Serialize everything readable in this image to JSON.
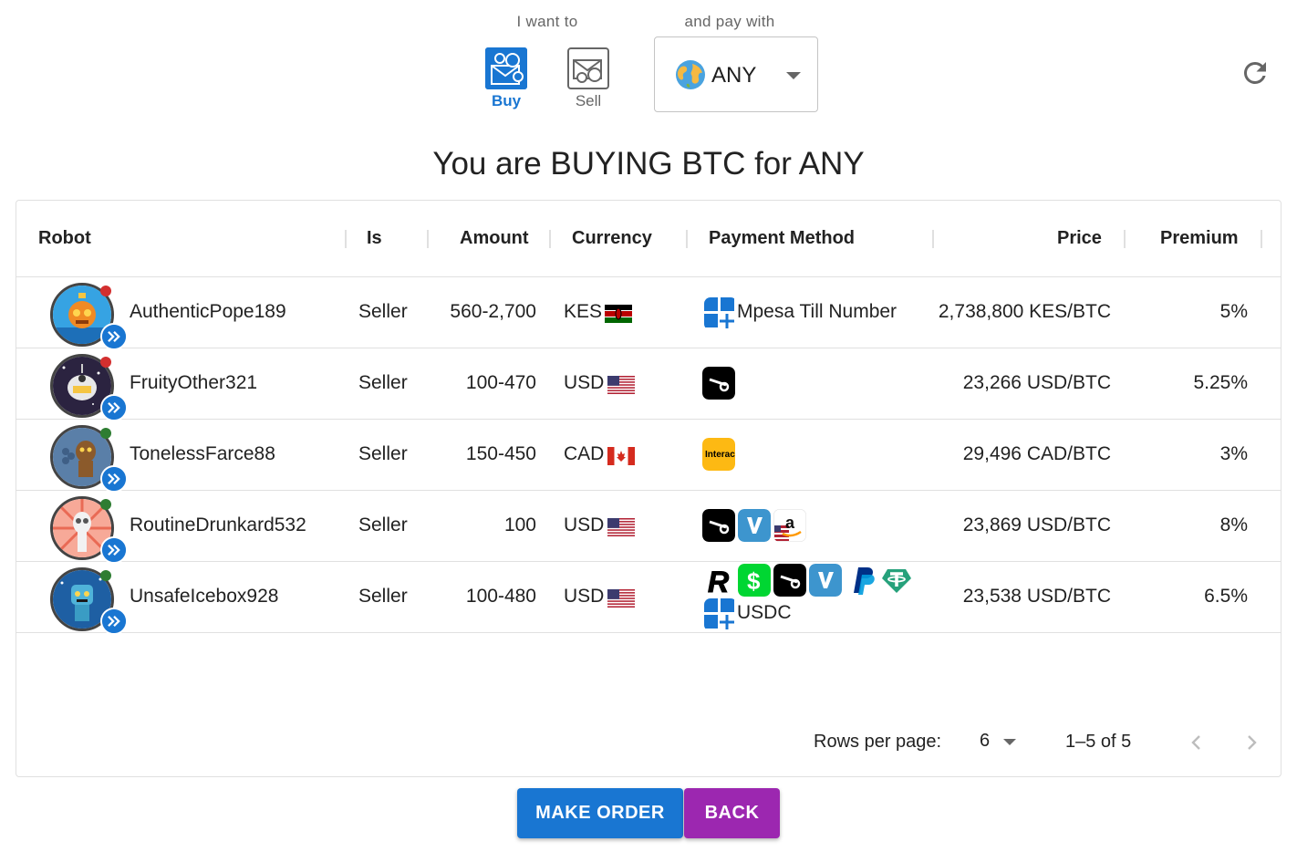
{
  "filters": {
    "want_label": "I want to",
    "pay_label": "and pay with",
    "buy_label": "Buy",
    "sell_label": "Sell",
    "currency_selected": "ANY",
    "accent_color": "#1976d2"
  },
  "title": "You are BUYING BTC for ANY",
  "table": {
    "headers": {
      "robot": "Robot",
      "is": "Is",
      "amount": "Amount",
      "currency": "Currency",
      "payment": "Payment Method",
      "price": "Price",
      "premium": "Premium"
    },
    "rows": [
      {
        "robot": "AuthenticPope189",
        "status": "red",
        "is": "Seller",
        "amount": "560-2,700",
        "currency": "KES",
        "flag": "kenya-flag",
        "methods": [
          "mpesa-icon"
        ],
        "method_text": "Mpesa Till Number",
        "price": "2,738,800 KES/BTC",
        "premium": "5%"
      },
      {
        "robot": "FruityOther321",
        "status": "red",
        "is": "Seller",
        "amount": "100-470",
        "currency": "USD",
        "flag": "usa-flag",
        "methods": [
          "strike-icon"
        ],
        "method_text": "",
        "price": "23,266 USD/BTC",
        "premium": "5.25%"
      },
      {
        "robot": "TonelessFarce88",
        "status": "green",
        "is": "Seller",
        "amount": "150-450",
        "currency": "CAD",
        "flag": "canada-flag",
        "methods": [
          "interac-icon"
        ],
        "method_text": "",
        "price": "29,496 CAD/BTC",
        "premium": "3%"
      },
      {
        "robot": "RoutineDrunkard532",
        "status": "green",
        "is": "Seller",
        "amount": "100",
        "currency": "USD",
        "flag": "usa-flag",
        "methods": [
          "strike-icon",
          "venmo-icon",
          "amazon-us-icon"
        ],
        "method_text": "",
        "price": "23,869 USD/BTC",
        "premium": "8%"
      },
      {
        "robot": "UnsafeIcebox928",
        "status": "green",
        "is": "Seller",
        "amount": "100-480",
        "currency": "USD",
        "flag": "usa-flag",
        "methods": [
          "revolut-icon",
          "cashapp-icon",
          "strike-icon",
          "venmo-icon",
          "paypal-icon",
          "tether-icon"
        ],
        "method_text": "USDC",
        "price": "23,538 USD/BTC",
        "premium": "6.5%"
      }
    ],
    "interac_text": "Interac"
  },
  "pagination": {
    "rows_per_page_label": "Rows per page:",
    "rows_per_page": "6",
    "range": "1–5 of 5"
  },
  "actions": {
    "make_order": "MAKE ORDER",
    "back": "BACK"
  }
}
